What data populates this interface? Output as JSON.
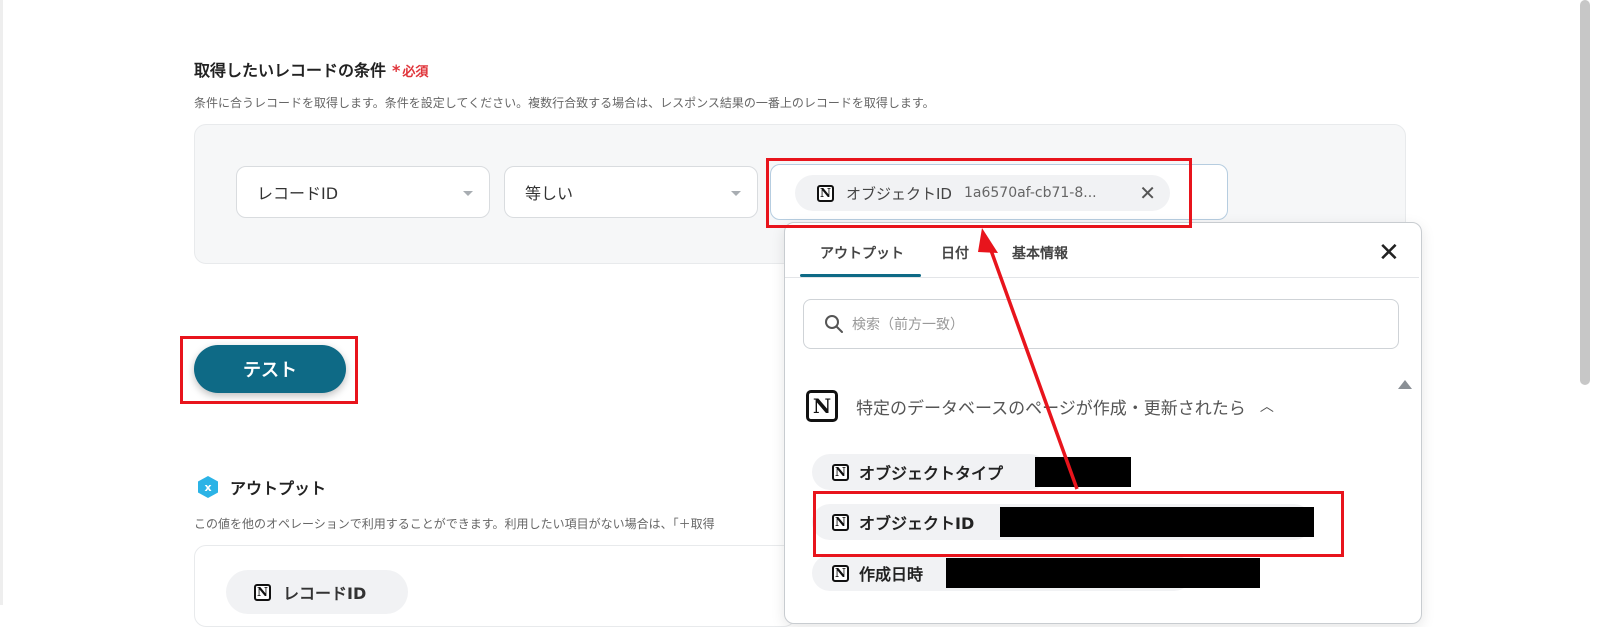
{
  "condition_section": {
    "title": "取得したいレコードの条件",
    "required_mark": "*",
    "required_label": "必須",
    "description": "条件に合うレコードを取得します。条件を設定してください。複数行合致する場合は、レスポンス結果の一番上のレコードを取得します。",
    "field_select": "レコードID",
    "operator_select": "等しい",
    "value_chip": {
      "label": "オブジェクトID",
      "value": "1a6570af-cb71-8..."
    }
  },
  "test_button_label": "テスト",
  "output_section": {
    "title": "アウトプット",
    "description": "この値を他のオペレーションで利用することができます。利用したい項目がない場合は、「＋取得",
    "first_item": "レコードID"
  },
  "popup": {
    "tabs": [
      "アウトプット",
      "日付",
      "基本情報"
    ],
    "active_tab": "アウトプット",
    "search_placeholder": "検索（前方一致）",
    "group_title": "特定のデータベースのページが作成・更新されたら",
    "items": [
      "オブジェクトタイプ",
      "オブジェクトID",
      "作成日時"
    ]
  },
  "icons": {
    "app": "notion-icon",
    "close": "close-icon",
    "search": "search-icon",
    "output": "output-hex-icon"
  },
  "colors": {
    "primary": "#0e6a86",
    "required": "#e0343a",
    "annotation": "#e8141c"
  }
}
